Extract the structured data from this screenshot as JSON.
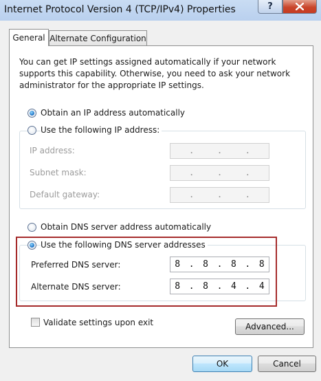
{
  "window": {
    "title": "Internet Protocol Version 4 (TCP/IPv4) Properties",
    "help_glyph": "?",
    "close_icon": "close-icon",
    "colors": {
      "titlebar": "#c3d7f2",
      "close": "#c9462c",
      "highlight": "#a52a2a"
    }
  },
  "tabs": [
    {
      "label": "General",
      "selected": true
    },
    {
      "label": "Alternate Configuration",
      "selected": false
    }
  ],
  "intro_lines": [
    "You can get IP settings assigned automatically if your network",
    "supports this capability. Otherwise, you need to ask your network",
    "administrator for the appropriate IP settings."
  ],
  "ip_section": {
    "auto_label": "Obtain an IP address automatically",
    "auto_selected": true,
    "manual_label": "Use the following IP address:",
    "manual_selected": false,
    "fields": [
      {
        "label": "IP address:",
        "value": [
          "",
          "",
          "",
          ""
        ]
      },
      {
        "label": "Subnet mask:",
        "value": [
          "",
          "",
          "",
          ""
        ]
      },
      {
        "label": "Default gateway:",
        "value": [
          "",
          "",
          "",
          ""
        ]
      }
    ]
  },
  "dns_section": {
    "auto_label": "Obtain DNS server address automatically",
    "auto_selected": false,
    "manual_label": "Use the following DNS server addresses",
    "manual_selected": true,
    "fields": [
      {
        "label": "Preferred DNS server:",
        "value": [
          "8",
          "8",
          "8",
          "8"
        ]
      },
      {
        "label": "Alternate DNS server:",
        "value": [
          "8",
          "8",
          "4",
          "4"
        ]
      }
    ]
  },
  "validate": {
    "label": "Validate settings upon exit",
    "checked": false
  },
  "buttons": {
    "advanced": "Advanced...",
    "ok": "OK",
    "cancel": "Cancel"
  },
  "dot": "."
}
